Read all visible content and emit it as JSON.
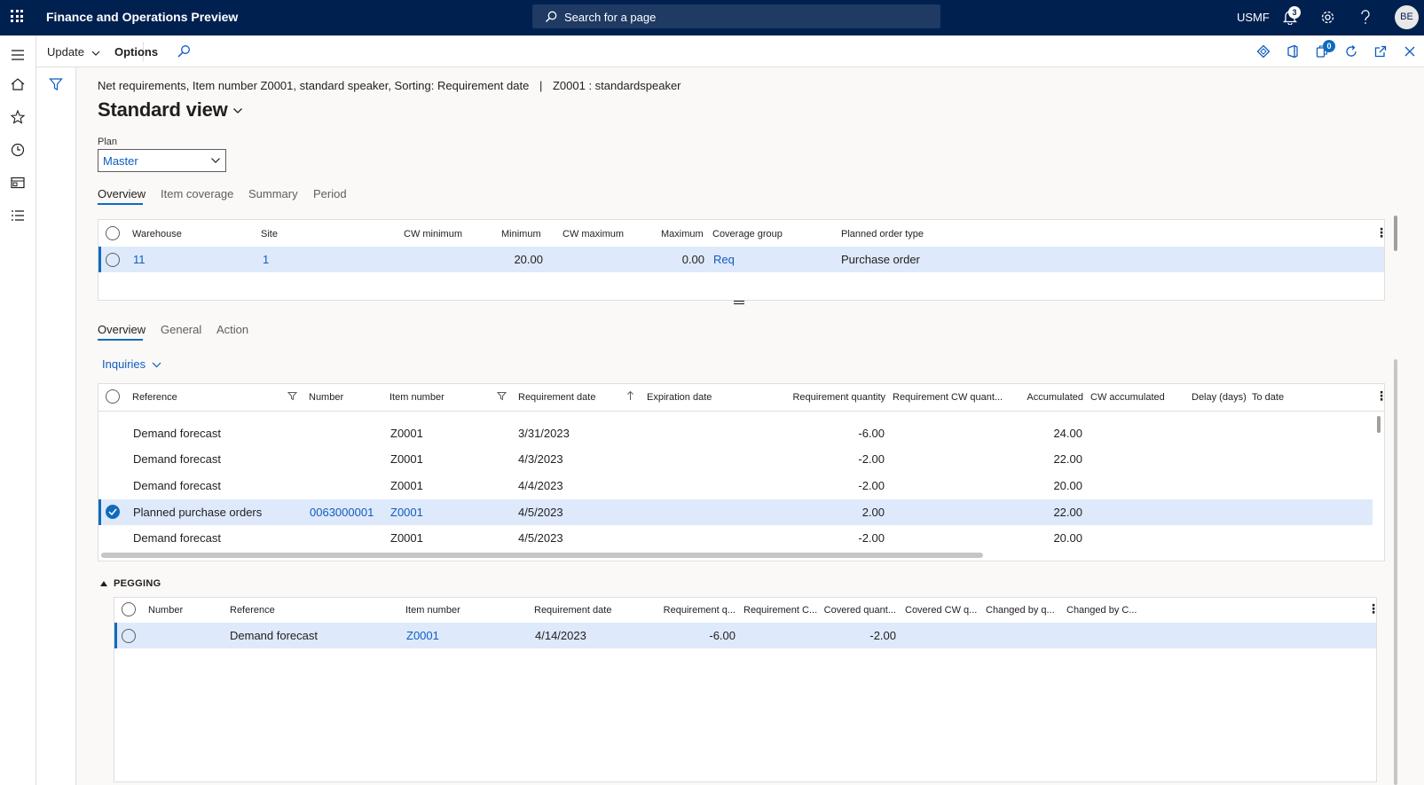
{
  "app": {
    "title": "Finance and Operations Preview",
    "search_placeholder": "Search for a page",
    "company": "USMF",
    "notifications_count": "3",
    "avatar_initials": "BE",
    "colors": {
      "nav_bar": "#002050",
      "accent": "#0f6cbd",
      "link": "#0f5cbf",
      "selected_row": "#dee9fb"
    }
  },
  "action_pane": {
    "update_label": "Update",
    "options_label": "Options",
    "attachments_count": "0"
  },
  "page": {
    "caption": "Net requirements, Item number Z0001, standard speaker, Sorting: Requirement date",
    "caption_separator": "|",
    "caption_item": "Z0001 : standardspeaker",
    "view_title": "Standard view",
    "plan_label": "Plan",
    "plan_value": "Master"
  },
  "top_tabs": [
    "Overview",
    "Item coverage",
    "Summary",
    "Period"
  ],
  "coverage_grid": {
    "headers": {
      "warehouse": "Warehouse",
      "site": "Site",
      "cw_minimum": "CW minimum",
      "minimum": "Minimum",
      "cw_maximum": "CW maximum",
      "maximum": "Maximum",
      "coverage_group": "Coverage group",
      "planned_order_type": "Planned order type"
    },
    "rows": [
      {
        "warehouse": "11",
        "site": "1",
        "cw_minimum": "",
        "minimum": "20.00",
        "cw_maximum": "",
        "maximum": "0.00",
        "coverage_group": "Req",
        "planned_order_type": "Purchase order"
      }
    ]
  },
  "lower_tabs": [
    "Overview",
    "General",
    "Action"
  ],
  "inquiries_label": "Inquiries",
  "requirements_grid": {
    "headers": {
      "reference": "Reference",
      "number": "Number",
      "item_number": "Item number",
      "requirement_date": "Requirement date",
      "expiration_date": "Expiration date",
      "requirement_quantity": "Requirement quantity",
      "requirement_cw_quantity": "Requirement CW quant...",
      "accumulated": "Accumulated",
      "cw_accumulated": "CW accumulated",
      "delay_days": "Delay (days)",
      "to_date": "To date"
    },
    "rows": [
      {
        "reference": "Demand forecast",
        "number": "",
        "item_number": "Z0001",
        "requirement_date": "3/31/2023",
        "requirement_quantity": "-6.00",
        "accumulated": "24.00"
      },
      {
        "reference": "Demand forecast",
        "number": "",
        "item_number": "Z0001",
        "requirement_date": "4/3/2023",
        "requirement_quantity": "-2.00",
        "accumulated": "22.00"
      },
      {
        "reference": "Demand forecast",
        "number": "",
        "item_number": "Z0001",
        "requirement_date": "4/4/2023",
        "requirement_quantity": "-2.00",
        "accumulated": "20.00"
      },
      {
        "reference": "Planned purchase orders",
        "number": "0063000001",
        "item_number": "Z0001",
        "requirement_date": "4/5/2023",
        "requirement_quantity": "2.00",
        "accumulated": "22.00"
      },
      {
        "reference": "Demand forecast",
        "number": "",
        "item_number": "Z0001",
        "requirement_date": "4/5/2023",
        "requirement_quantity": "-2.00",
        "accumulated": "20.00"
      }
    ]
  },
  "pegging": {
    "title": "PEGGING",
    "headers": {
      "number": "Number",
      "reference": "Reference",
      "item_number": "Item number",
      "requirement_date": "Requirement date",
      "requirement_q": "Requirement q...",
      "requirement_c": "Requirement C...",
      "covered_quant": "Covered quant...",
      "covered_cw_q": "Covered CW q...",
      "changed_by_q": "Changed by q...",
      "changed_by_c": "Changed by C..."
    },
    "rows": [
      {
        "number": "",
        "reference": "Demand forecast",
        "item_number": "Z0001",
        "requirement_date": "4/14/2023",
        "requirement_q": "-6.00",
        "covered_quant": "-2.00"
      }
    ]
  }
}
